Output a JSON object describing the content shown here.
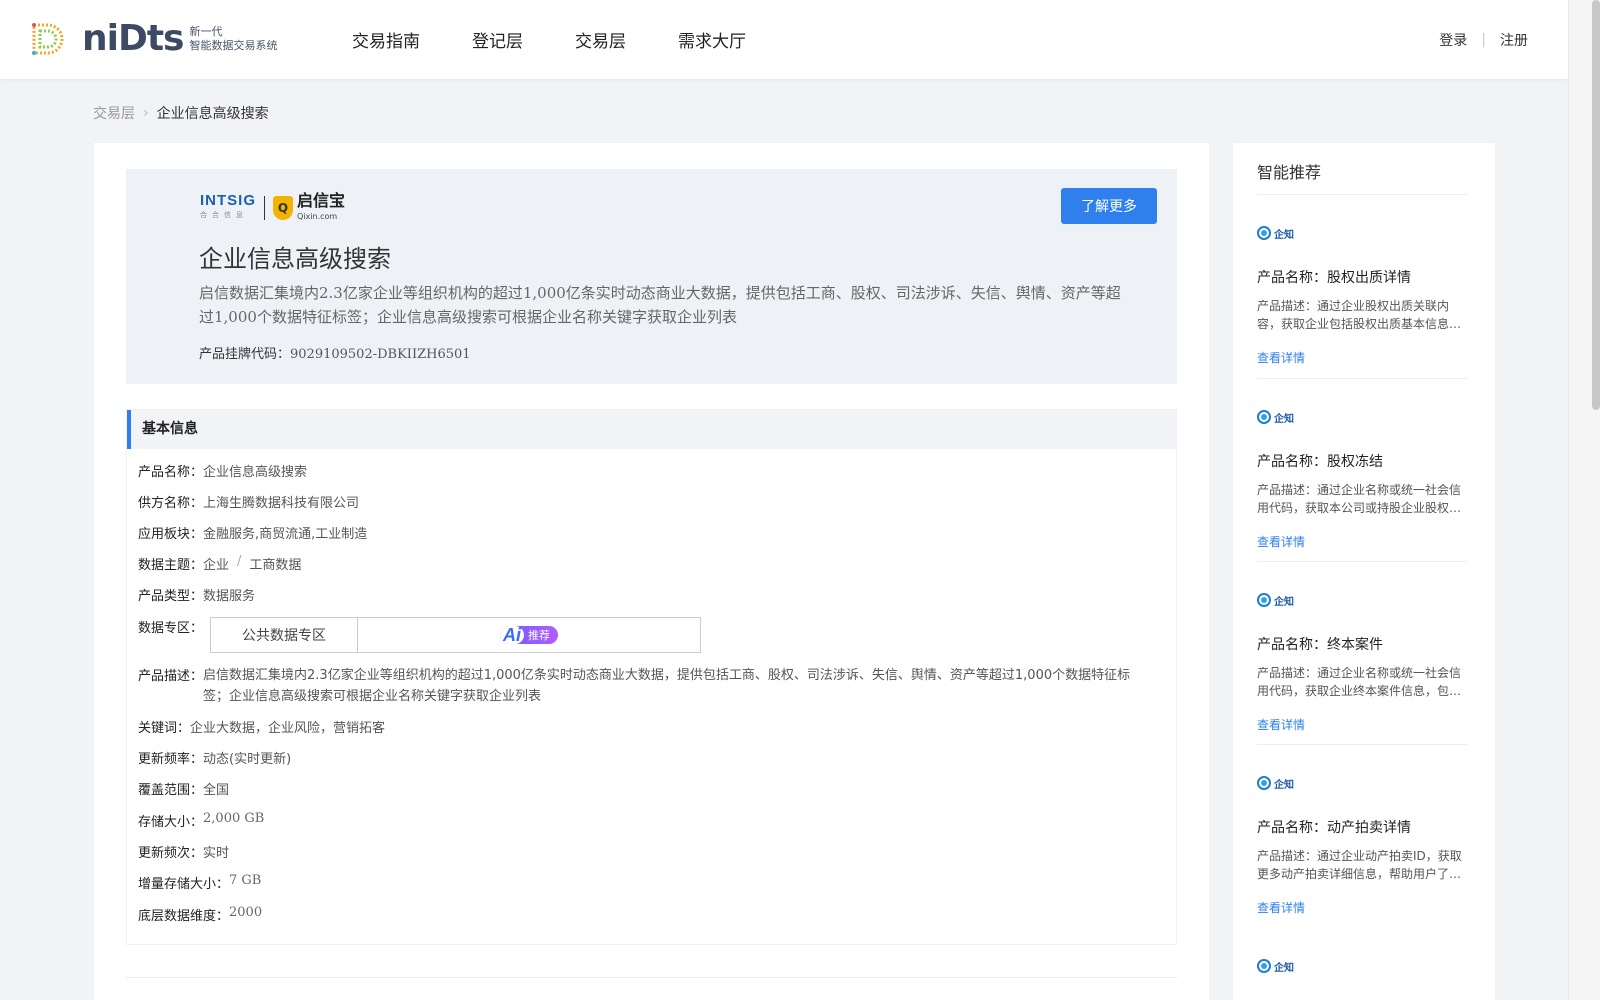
{
  "brand": {
    "logo_word": "niDts",
    "tag_line1": "新一代",
    "tag_line2": "智能数据交易系统"
  },
  "nav": [
    "交易指南",
    "登记层",
    "交易层",
    "需求大厅"
  ],
  "auth": {
    "login": "登录",
    "divider": "|",
    "register": "注册"
  },
  "breadcrumb": {
    "parent": "交易层",
    "current": "企业信息高级搜索"
  },
  "hero": {
    "partner_intsig": "INTSIG",
    "partner_intsig_sub": "合合信息",
    "partner_qixin": "启信宝",
    "partner_qixin_domain": "Qixin.com",
    "title": "企业信息高级搜索",
    "description": "启信数据汇集境内2.3亿家企业等组织机构的超过1,000亿条实时动态商业大数据，提供包括工商、股权、司法涉诉、失信、舆情、资产等超过1,000个数据特征标签；企业信息高级搜索可根据企业名称关键字获取企业列表",
    "code_label": "产品挂牌代码：",
    "code_value": "9029109502-DBKIIZH6501",
    "more_button": "了解更多"
  },
  "info": {
    "section_title": "基本信息",
    "product_name": {
      "label": "产品名称：",
      "value": "企业信息高级搜索"
    },
    "supplier": {
      "label": "供方名称：",
      "value": "上海生腾数据科技有限公司"
    },
    "sector": {
      "label": "应用板块：",
      "value": "金融服务,商贸流通,工业制造"
    },
    "topic": {
      "label": "数据主题：",
      "value1": "企业",
      "sep": "/",
      "value2": "工商数据"
    },
    "type": {
      "label": "产品类型：",
      "value": "数据服务"
    },
    "zone": {
      "label": "数据专区：",
      "cell": "公共数据专区",
      "badge_ai": "Ai",
      "badge_text": "推荐"
    },
    "desc": {
      "label": "产品描述：",
      "value": "启信数据汇集境内2.3亿家企业等组织机构的超过1,000亿条实时动态商业大数据，提供包括工商、股权、司法涉诉、失信、舆情、资产等超过1,000个数据特征标签；企业信息高级搜索可根据企业名称关键字获取企业列表"
    },
    "keywords": {
      "label": "关键词：",
      "value": "企业大数据，企业风险，营销拓客"
    },
    "update_freq": {
      "label": "更新频率：",
      "value": "动态(实时更新)"
    },
    "coverage": {
      "label": "覆盖范围：",
      "value": "全国"
    },
    "storage": {
      "label": "存储大小：",
      "value": "2,000 GB"
    },
    "update_times": {
      "label": "更新频次：",
      "value": "实时"
    },
    "increment": {
      "label": "增量存储大小：",
      "value": "7 GB"
    },
    "dimension": {
      "label": "底层数据维度：",
      "value": "2000"
    }
  },
  "sidebar": {
    "title": "智能推荐",
    "logo_text": "企知",
    "link_label": "查看详情",
    "items": [
      {
        "name": "产品名称：股权出质详情",
        "desc": "产品描述：通过企业股权出质关联内容，获取企业包括股权出质基本信息等详细内容"
      },
      {
        "name": "产品名称：股权冻结",
        "desc": "产品描述：通过企业名称或统一社会信用代码，获取本公司或持股企业股权冻结信息"
      },
      {
        "name": "产品名称：终本案件",
        "desc": "产品描述：通过企业名称或统一社会信用代码，获取企业终本案件信息，包括案号等"
      },
      {
        "name": "产品名称：动产拍卖详情",
        "desc": "产品描述：通过企业动产拍卖ID，获取更多动产拍卖详细信息，帮助用户了解详情"
      }
    ]
  }
}
